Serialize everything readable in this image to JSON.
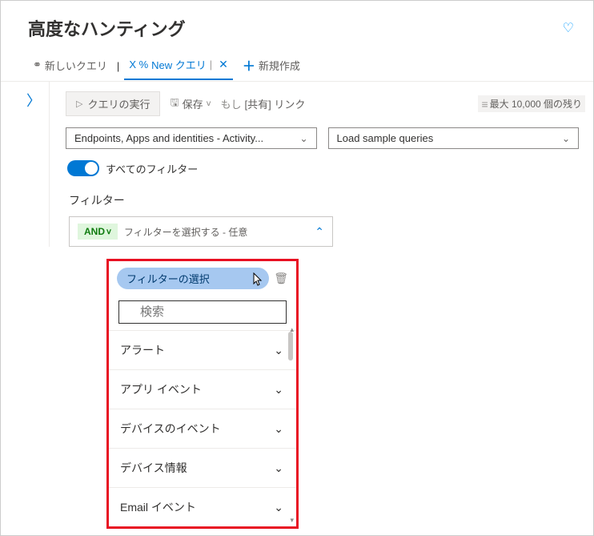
{
  "header": {
    "title": "高度なハンティング"
  },
  "tabs": {
    "first": "新しいクエリ",
    "active_prefix": "X %",
    "active": "New クエリ",
    "new": "新規作成"
  },
  "toolbar": {
    "run": "クエリの実行",
    "save": "保存",
    "share": "[共有] リンク",
    "share_prefix": "もし",
    "remaining": "最大 10,000 個の残り"
  },
  "selectors": {
    "schema": "Endpoints, Apps and identities - Activity...",
    "samples": "Load sample queries"
  },
  "toggle_label": "すべてのフィルター",
  "section_label": "フィルター",
  "and_block": {
    "badge": "AND",
    "text": "フィルターを選択する - 任意"
  },
  "dropdown": {
    "pill": "フィルターの選択",
    "search_placeholder": "検索",
    "categories": [
      "アラート",
      "アプリ イベント",
      "デバイスのイベント",
      "デバイス情報",
      "Email イベント"
    ]
  }
}
